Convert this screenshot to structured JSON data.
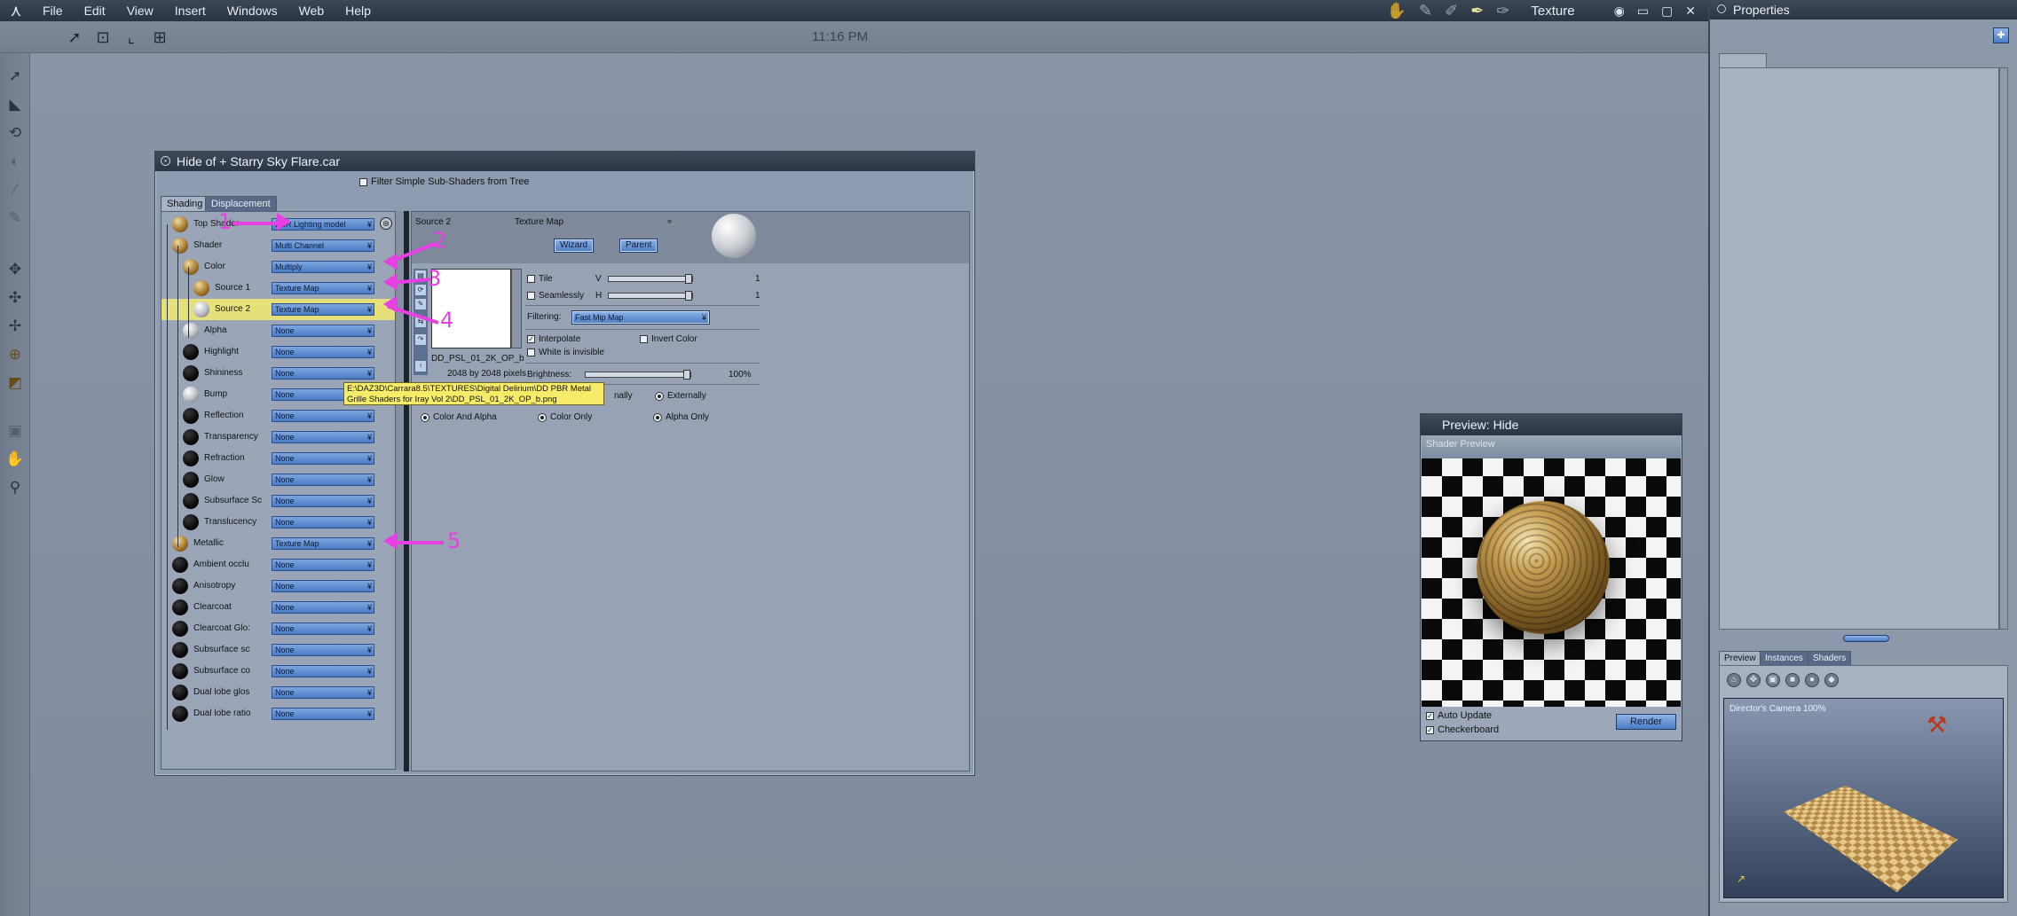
{
  "menubar": {
    "items": [
      "File",
      "Edit",
      "View",
      "Insert",
      "Windows",
      "Web",
      "Help"
    ],
    "room_name": "Texture",
    "clock": "11:16 PM"
  },
  "shader_window": {
    "title": "Hide of + Starry Sky Flare.car",
    "filter_label": "Filter Simple Sub-Shaders from Tree",
    "tabs": [
      "Shading",
      "Displacement"
    ],
    "tree": [
      {
        "label": "Top Shader",
        "value": "PBR Lighting model",
        "ball": "gold"
      },
      {
        "label": "Shader",
        "value": "Multi Channel",
        "ball": "gold"
      },
      {
        "label": "Color",
        "value": "Multiply",
        "ball": "gold"
      },
      {
        "label": "Source 1",
        "value": "Texture Map",
        "ball": "gold"
      },
      {
        "label": "Source 2",
        "value": "Texture Map",
        "ball": "grey",
        "highlight": true
      },
      {
        "label": "Alpha",
        "value": "None",
        "ball": "grey"
      },
      {
        "label": "Highlight",
        "value": "None",
        "ball": "black"
      },
      {
        "label": "Shininess",
        "value": "None",
        "ball": "black"
      },
      {
        "label": "Bump",
        "value": "None",
        "ball": "grey"
      },
      {
        "label": "Reflection",
        "value": "None",
        "ball": "black"
      },
      {
        "label": "Transparency",
        "value": "None",
        "ball": "black"
      },
      {
        "label": "Refraction",
        "value": "None",
        "ball": "black"
      },
      {
        "label": "Glow",
        "value": "None",
        "ball": "black"
      },
      {
        "label": "Subsurface Sc",
        "value": "None",
        "ball": "black"
      },
      {
        "label": "Translucency",
        "value": "None",
        "ball": "black"
      },
      {
        "label": "Metallic",
        "value": "Texture Map",
        "ball": "gold"
      },
      {
        "label": "Ambient occlu",
        "value": "None",
        "ball": "black"
      },
      {
        "label": "Anisotropy",
        "value": "None",
        "ball": "black"
      },
      {
        "label": "Clearcoat",
        "value": "None",
        "ball": "black"
      },
      {
        "label": "Clearcoat Glo:",
        "value": "None",
        "ball": "black"
      },
      {
        "label": "Subsurface sc",
        "value": "None",
        "ball": "black"
      },
      {
        "label": "Subsurface co",
        "value": "None",
        "ball": "black"
      },
      {
        "label": "Dual lobe glos",
        "value": "None",
        "ball": "black"
      },
      {
        "label": "Dual lobe ratio",
        "value": "None",
        "ball": "black"
      }
    ],
    "editor": {
      "channel": "Source 2",
      "type": "Texture Map",
      "wizard_label": "Wizard",
      "parent_label": "Parent",
      "file_name": "DD_PSL_01_2K_OP_b.png",
      "dimensions": "2048 by 2048 pixels",
      "tile_label": "Tile",
      "seamlessly_label": "Seamlessly",
      "v_label": "V",
      "h_label": "H",
      "v_value": "1",
      "h_value": "1",
      "filtering_label": "Filtering:",
      "filtering_value": "Fast Mip Map",
      "interpolate_label": "Interpolate",
      "invert_label": "Invert Color",
      "white_invisible_label": "White is invisible",
      "brightness_label": "Brightness:",
      "brightness_value": "100%",
      "internally_label": "nally",
      "externally_label": "Externally",
      "color_and_alpha_label": "Color And Alpha",
      "color_only_label": "Color Only",
      "alpha_only_label": "Alpha Only"
    },
    "tooltip_line1": "E:\\DAZ3D\\Carrara8.5\\TEXTURES\\Digital Delirium\\DD PBR Metal",
    "tooltip_line2": "Grille Shaders for Iray Vol 2\\DD_PSL_01_2K_OP_b.png"
  },
  "annotations": [
    "1",
    "2",
    "3",
    "4",
    "5"
  ],
  "preview_window": {
    "title": "Preview: Hide",
    "overlay_label": "Shader Preview",
    "auto_update_label": "Auto Update",
    "checkerboard_label": "Checkerboard",
    "render_label": "Render"
  },
  "properties": {
    "title": "Properties",
    "tabs": [
      "Preview",
      "Instances",
      "Shaders"
    ],
    "scene_label": "Director's Camera 100%"
  },
  "colors": {
    "accent": "#4b7cc4",
    "annotation": "#e83fe3",
    "highlight_row": "#e6e07a"
  }
}
